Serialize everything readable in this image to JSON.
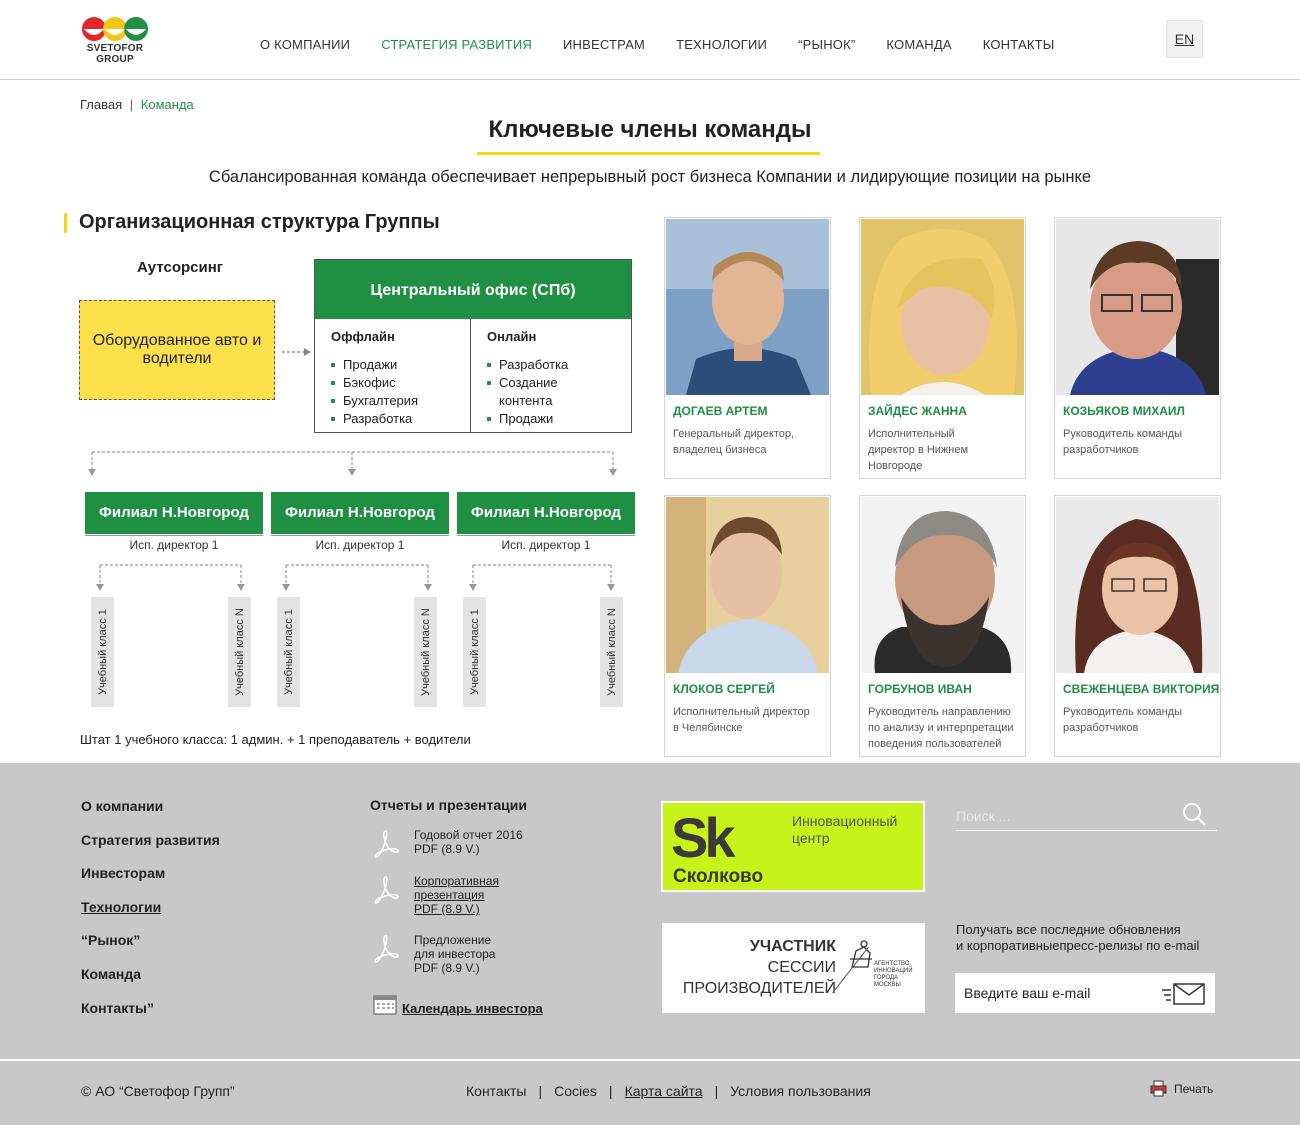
{
  "header": {
    "logo_line1": "SVETOFOR",
    "logo_line2": "GROUP",
    "nav": [
      "О КОМПАНИИ",
      "СТРАТЕГИЯ РАЗВИТИЯ",
      "ИНВЕСТРАМ",
      "ТЕХНОЛОГИИ",
      "“РЫНОК”",
      "КОМАНДА",
      "КОНТАКТЫ"
    ],
    "active_nav": "СТРАТЕГИЯ РАЗВИТИЯ",
    "lang": "EN"
  },
  "breadcrumb": {
    "home": "Главая",
    "sep": "|",
    "current": "Команда"
  },
  "page_title": "Ключевые члены команды",
  "subtitle": "Сбалансированная команда обеспечивает непрерывный рост бизнеса Компании и лидирующие позиции на рынке",
  "org": {
    "title": "Организационная структура Группы",
    "outsource_label": "Аутсорсинг",
    "outsource_box": "Оборудованное авто и водители",
    "office_title": "Центральный офис (СПб)",
    "offline_title": "Оффлайн",
    "offline_items": [
      "Продажи",
      "Бэкофис",
      "Бухгалтерия",
      "Разработка"
    ],
    "online_title": "Онлайн",
    "online_items": [
      "Разработка",
      "Создание контента",
      "Продажи"
    ],
    "branches": [
      {
        "name": "Филиал Н.Новгород",
        "director": "Исп. директор 1",
        "class_first": "Учебный класс 1",
        "class_last": "Учебный класс N"
      },
      {
        "name": "Филиал Н.Новгород",
        "director": "Исп. директор 1",
        "class_first": "Учебный класс 1",
        "class_last": "Учебный класс N"
      },
      {
        "name": "Филиал Н.Новгород",
        "director": "Исп. директор 1",
        "class_first": "Учебный класс 1",
        "class_last": "Учебный класс N"
      }
    ],
    "staff_note": "Штат 1 учебного класса: 1 админ. + 1 преподаватель + водители"
  },
  "team": [
    {
      "name": "ДОГАЕВ АРТЕМ",
      "role": "Генеральный директор, владелец бизнеса"
    },
    {
      "name": "ЗАЙДЕС ЖАННА",
      "role": "Исполнительный директор в Нижнем Новгороде"
    },
    {
      "name": "КОЗЬЯКОВ МИХАИЛ",
      "role": "Руководитель команды разработчиков"
    },
    {
      "name": "КЛОКОВ СЕРГЕЙ",
      "role": "Исполнительный директор в Челябинске"
    },
    {
      "name": "ГОРБУНОВ ИВАН",
      "role": "Руководитель направлению по анализу и интерпретации поведения пользователей"
    },
    {
      "name": "СВЕЖЕНЦЕВА ВИКТОРИЯ",
      "role": "Руководитель команды разработчиков"
    }
  ],
  "footer": {
    "nav": [
      "О компании",
      "Стратегия развития",
      "Инвесторам",
      "Технологии",
      "“Рынок”",
      "Команда",
      "Контакты”"
    ],
    "reports_title": "Отчеты и презентации",
    "reports": [
      {
        "line1": "Годовой отчет 2016",
        "line2": "PDF (8.9 V.)",
        "line3": ""
      },
      {
        "line1": "Корпоративная",
        "line2": "презентация",
        "line3": "PDF (8.9 V.)"
      },
      {
        "line1": "Предложение",
        "line2": "для инвестора",
        "line3": "PDF (8.9 V.)"
      }
    ],
    "calendar_link": "Календарь инвестора",
    "skolkovo": {
      "logo": "Sk",
      "city": "Сколково",
      "center": "Инновационный центр"
    },
    "participant": {
      "line1": "УЧАСТНИК",
      "line2": "СЕССИИ",
      "line3": "ПРОИЗВОДИТЕЛЕЙ",
      "agency": "АГЕНТСТВО ИННОВАЦИЙ ГОРОДА МОСКВЫ"
    },
    "search_placeholder": "Поиск ...",
    "subscribe_line1": "Получать все последние обновления",
    "subscribe_line2": "и корпоративныепресс-релизы по e-mail",
    "email_placeholder": "Введите ваш e-mail",
    "copyright": "© АО “Светофор Групп”",
    "bottom_links": [
      "Контакты",
      "Cocies",
      "Карта сайта",
      "Условия пользования"
    ],
    "print": "Печать"
  }
}
